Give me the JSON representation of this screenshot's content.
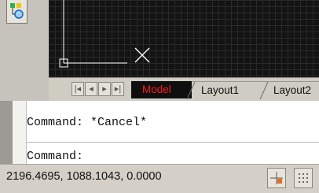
{
  "tabs": [
    "Model",
    "Layout1",
    "Layout2"
  ],
  "active_tab": "Model",
  "command_history": [
    "Command: *Cancel*"
  ],
  "command_prompt": "Command:",
  "status": {
    "coordinates": "2196.4695, 1088.1043, 0.0000"
  },
  "colors": {
    "canvas_background": "#131313",
    "grid": "#2a2a2a",
    "active_tab_text": "#ff1a1a",
    "crosshair": "#ffffff"
  },
  "icons": [
    "tool-icon",
    "first-tab-icon",
    "prev-tab-icon",
    "next-tab-icon",
    "last-tab-icon",
    "snap-icon",
    "grid-icon"
  ]
}
